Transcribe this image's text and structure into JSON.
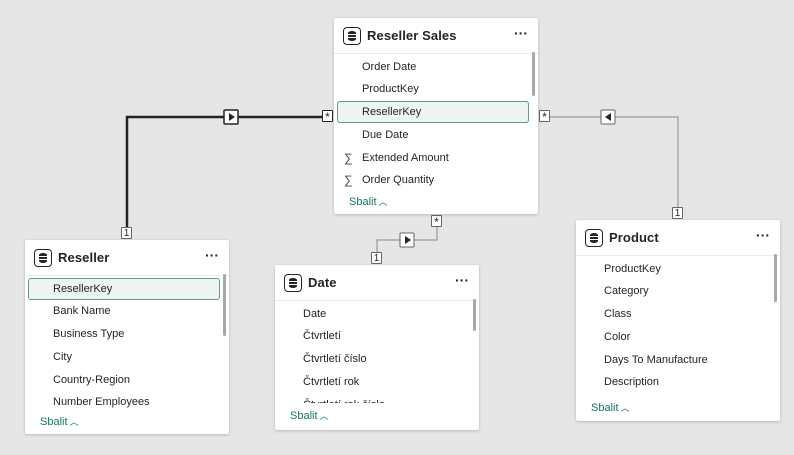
{
  "tables": {
    "reseller_sales": {
      "title": "Reseller Sales",
      "more": "···",
      "fields": [
        "Order Date",
        "ProductKey",
        "ResellerKey",
        "Due Date",
        "Extended Amount",
        "Order Quantity"
      ],
      "collapse": "Sbalit"
    },
    "reseller": {
      "title": "Reseller",
      "more": "···",
      "fields": [
        "ResellerKey",
        "Bank Name",
        "Business Type",
        "City",
        "Country-Region",
        "Number Employees"
      ],
      "collapse": "Sbalit"
    },
    "date": {
      "title": "Date",
      "more": "···",
      "fields": [
        "Date",
        "Čtvrtletí",
        "Čtvrtletí číslo",
        "Čtvrtletí rok",
        "Čtvrtletí rok číslo"
      ],
      "collapse": "Sbalit"
    },
    "product": {
      "title": "Product",
      "more": "···",
      "fields": [
        "ProductKey",
        "Category",
        "Class",
        "Color",
        "Days To Manufacture",
        "Description"
      ],
      "collapse": "Sbalit"
    }
  },
  "relationships": {
    "reseller_to_sales": {
      "from_card": "1",
      "to_card": "*"
    },
    "date_to_sales": {
      "from_card": "1",
      "to_card": "*"
    },
    "product_to_sales": {
      "from_card": "1",
      "to_card": "*"
    }
  },
  "colors": {
    "accent": "#117865",
    "selected_border": "#5f9f83",
    "line_active": "#252423",
    "line_inactive": "#888888"
  }
}
